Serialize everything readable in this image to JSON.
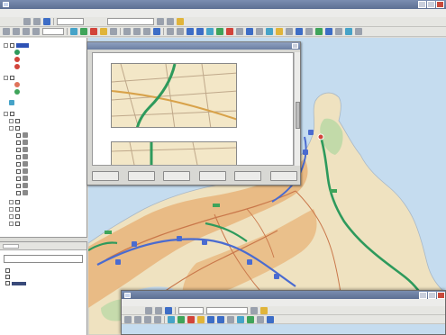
{
  "app": {
    "title": "",
    "menus": [
      "",
      "",
      "",
      "",
      "",
      "",
      "",
      ""
    ],
    "toolbar": {
      "dropdown_1": "",
      "dropdown_2": "",
      "zoom_value": ""
    }
  },
  "layers_panel": {
    "items": [
      {
        "label": ""
      },
      {
        "label": ""
      },
      {
        "label": ""
      },
      {
        "label": ""
      },
      {
        "label": ""
      },
      {
        "label": ""
      },
      {
        "label": ""
      },
      {
        "label": ""
      },
      {
        "label": ""
      },
      {
        "label": ""
      },
      {
        "label": ""
      }
    ]
  },
  "bottom_panel": {
    "tab": "",
    "combo_value": "",
    "items": [
      {
        "label": ""
      },
      {
        "label": ""
      },
      {
        "label": ""
      }
    ]
  },
  "directions_dialog": {
    "title": "",
    "steps": [
      {
        "index": "",
        "text": "",
        "distance": "",
        "time": ""
      },
      {
        "index": "",
        "text": "",
        "distance": "",
        "time": ""
      }
    ],
    "buttons": [
      "",
      "",
      "",
      "",
      "",
      ""
    ]
  },
  "second_window": {
    "title": "",
    "menus": [
      "",
      "",
      "",
      "",
      "",
      "",
      ""
    ],
    "toolbar": {
      "dropdown_1": "",
      "dropdown_2": ""
    }
  },
  "colors": {
    "water": "#c5dcef",
    "land": "#efe2c0",
    "urban": "#e8b47a",
    "park": "#bcd9a6",
    "route": "#2e9a5c",
    "highway": "#4a6bd0",
    "road": "#c9774a",
    "selection": "#2e52b5"
  }
}
